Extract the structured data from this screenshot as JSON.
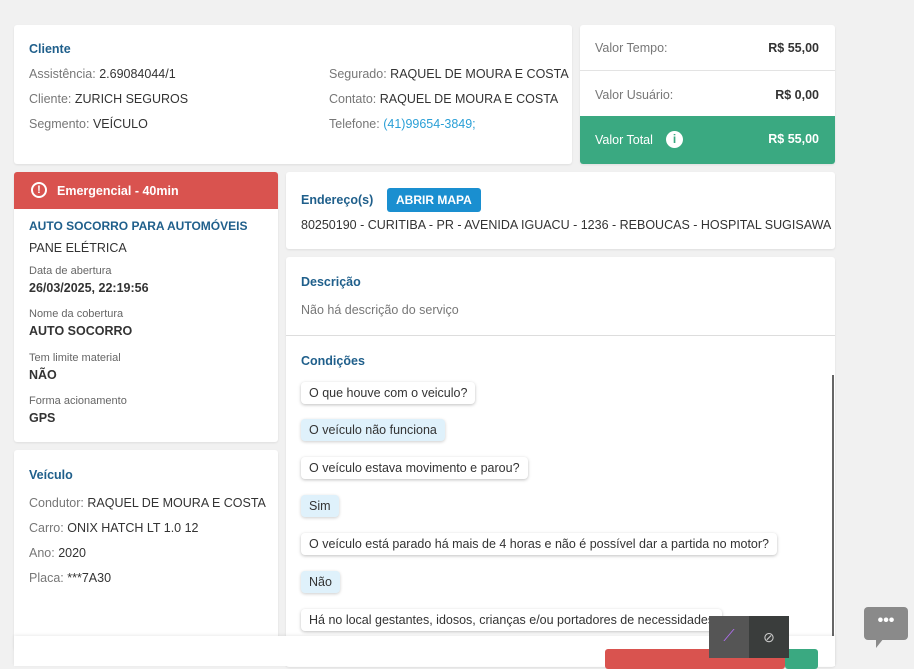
{
  "cliente": {
    "title": "Cliente",
    "assistencia_label": "Assistência:",
    "assistencia": "2.69084044/1",
    "cliente_label": "Cliente:",
    "cliente": "ZURICH SEGUROS",
    "segmento_label": "Segmento:",
    "segmento": "VEÍCULO",
    "segurado_label": "Segurado:",
    "segurado": "RAQUEL DE MOURA E COSTA",
    "contato_label": "Contato:",
    "contato": "RAQUEL DE MOURA E COSTA",
    "telefone_label": "Telefone:",
    "telefone": "(41)99654-3849;"
  },
  "valores": {
    "tempo_label": "Valor Tempo:",
    "tempo": "R$ 55,00",
    "usuario_label": "Valor Usuário:",
    "usuario": "R$ 0,00",
    "total_label": "Valor Total",
    "total": "R$ 55,00"
  },
  "servico": {
    "badge": "Emergencial - 40min",
    "tipo": "AUTO SOCORRO PARA AUTOMÓVEIS",
    "problema": "PANE ELÉTRICA",
    "abertura_label": "Data de abertura",
    "abertura": "26/03/2025, 22:19:56",
    "cobertura_label": "Nome da cobertura",
    "cobertura": "AUTO SOCORRO",
    "limite_label": "Tem limite material",
    "limite": "NÃO",
    "acionamento_label": "Forma acionamento",
    "acionamento": "GPS"
  },
  "veiculo": {
    "title": "Veículo",
    "condutor_label": "Condutor:",
    "condutor": "RAQUEL DE MOURA E COSTA",
    "carro_label": "Carro:",
    "carro": "ONIX HATCH LT 1.0 12",
    "ano_label": "Ano:",
    "ano": "2020",
    "placa_label": "Placa:",
    "placa": "***7A30"
  },
  "endereco": {
    "title": "Endereço(s)",
    "map_button": "ABRIR MAPA",
    "address": "80250190 - CURITIBA - PR - AVENIDA IGUACU - 1236 - REBOUCAS - HOSPITAL SUGISAWA"
  },
  "descricao": {
    "title": "Descrição",
    "text": "Não há descrição do serviço"
  },
  "condicoes": {
    "title": "Condições",
    "items": [
      "O que houve com o veiculo?",
      "O veículo não funciona",
      "O veículo estava movimento e parou?",
      "Sim",
      "O veículo está parado há mais de 4 horas e não é possível dar a partida no motor?",
      "Não",
      "Há no local gestantes, idosos, crianças e/ou portadores de necessidades"
    ]
  },
  "colors": {
    "accent": "#1f5f8b",
    "green": "#3aa981",
    "red": "#d9534f",
    "button": "#1a8fd0"
  }
}
